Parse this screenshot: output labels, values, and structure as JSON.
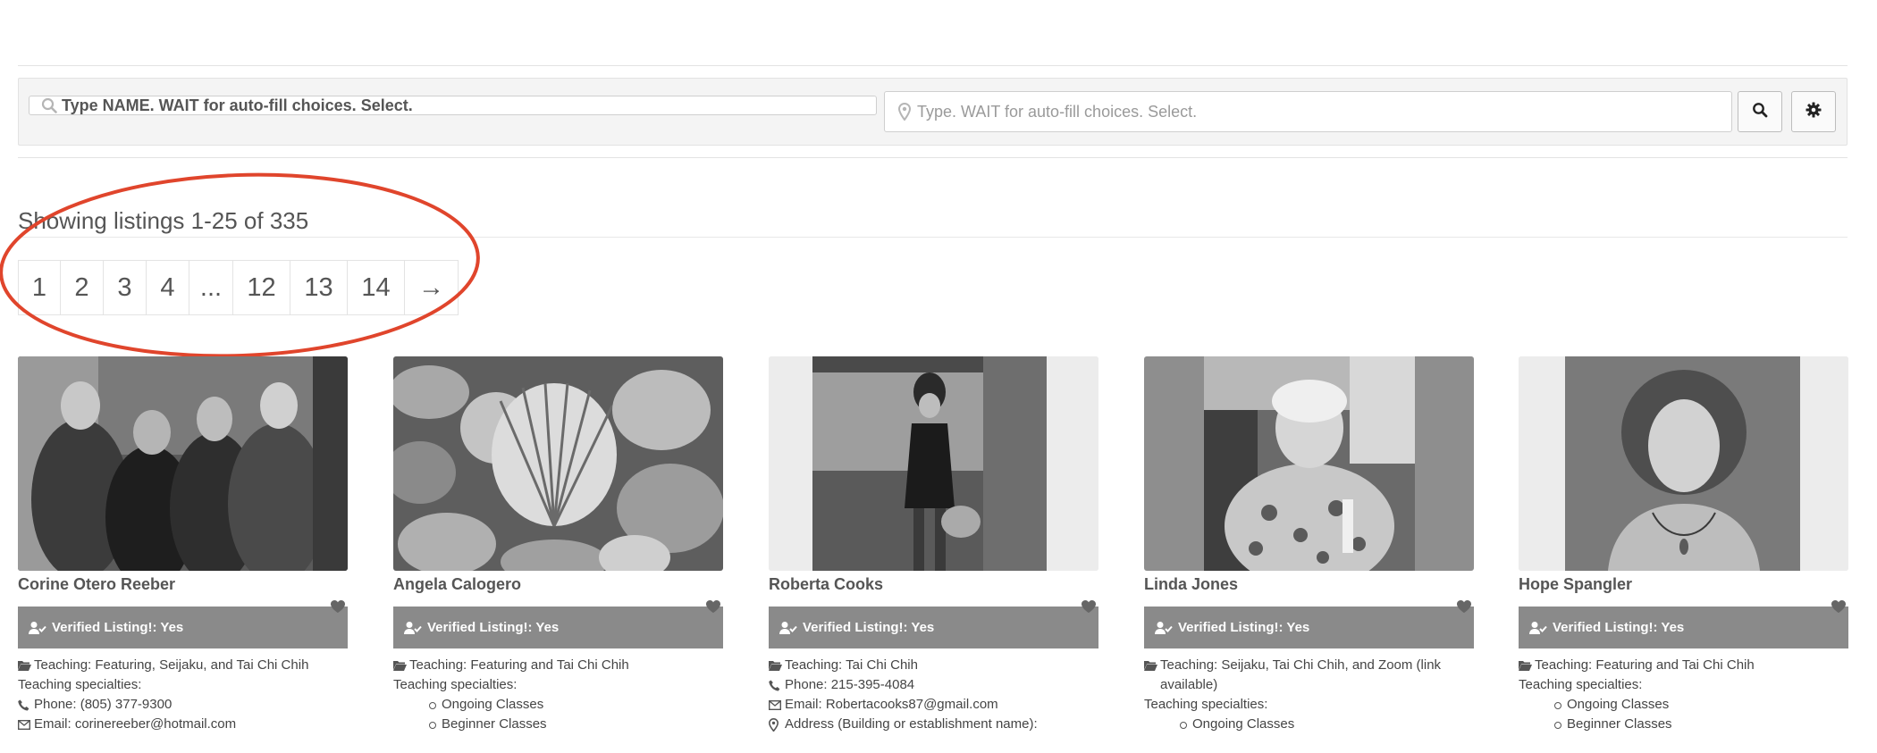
{
  "search": {
    "name_placeholder": "Type NAME. WAIT for auto-fill choices. Select.",
    "location_placeholder": "Type. WAIT for auto-fill choices. Select."
  },
  "results": {
    "showing_text": "Showing listings 1-25 of 335"
  },
  "pagination": {
    "pages": [
      "1",
      "2",
      "3",
      "4",
      "...",
      "12",
      "13",
      "14",
      "→"
    ]
  },
  "listings": [
    {
      "name": "Corine Otero Reeber",
      "verified": "Verified Listing!: Yes",
      "teaching": "Teaching: Featuring, Seijaku, and Tai Chi Chih",
      "specialties_label": "Teaching specialties:",
      "phone": "Phone: (805) 377-9300",
      "email": "Email: corinereeber@hotmail.com"
    },
    {
      "name": "Angela Calogero",
      "verified": "Verified Listing!: Yes",
      "teaching": "Teaching: Featuring and Tai Chi Chih",
      "specialties_label": "Teaching specialties:",
      "specialties": [
        "Ongoing Classes",
        "Beginner Classes"
      ]
    },
    {
      "name": "Roberta Cooks",
      "verified": "Verified Listing!: Yes",
      "teaching": "Teaching: Tai Chi Chih",
      "phone": "Phone: 215-395-4084",
      "email": "Email: Robertacooks87@gmail.com",
      "address": "Address (Building or establishment name):"
    },
    {
      "name": "Linda Jones",
      "verified": "Verified Listing!: Yes",
      "teaching": "Teaching: Seijaku, Tai Chi Chih, and Zoom (link available)",
      "specialties_label": "Teaching specialties:",
      "specialties": [
        "Ongoing Classes"
      ]
    },
    {
      "name": "Hope Spangler",
      "verified": "Verified Listing!: Yes",
      "teaching": "Teaching: Featuring and Tai Chi Chih",
      "specialties_label": "Teaching specialties:",
      "specialties": [
        "Ongoing Classes",
        "Beginner Classes"
      ]
    }
  ]
}
